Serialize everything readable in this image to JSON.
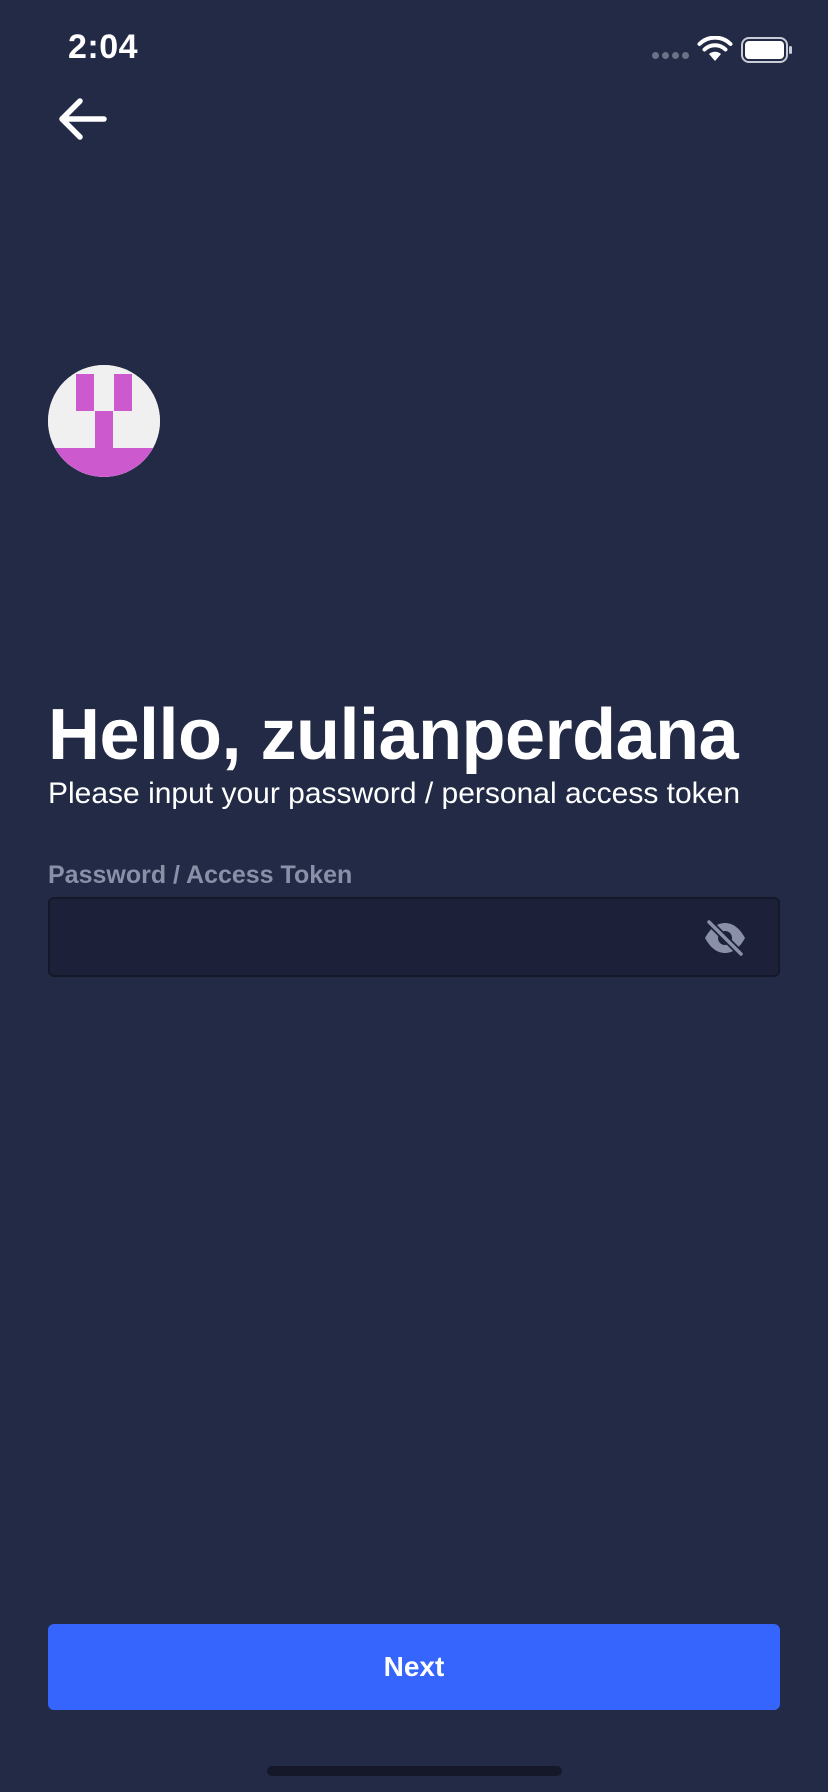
{
  "status_bar": {
    "time": "2:04"
  },
  "navigation": {
    "back_icon": "arrow-left-icon"
  },
  "avatar": {
    "icon": "identicon",
    "color": "#CC5ACE"
  },
  "greeting": {
    "title": "Hello, zulianperdana",
    "subtitle": "Please input your password / personal access token"
  },
  "password_field": {
    "label": "Password / Access Token",
    "value": "",
    "visibility_icon": "eye-off-icon"
  },
  "next_button": {
    "label": "Next"
  },
  "colors": {
    "background": "#222A45",
    "input_background": "#1C2139",
    "label": "#8990A8",
    "accent": "#3565FD"
  }
}
